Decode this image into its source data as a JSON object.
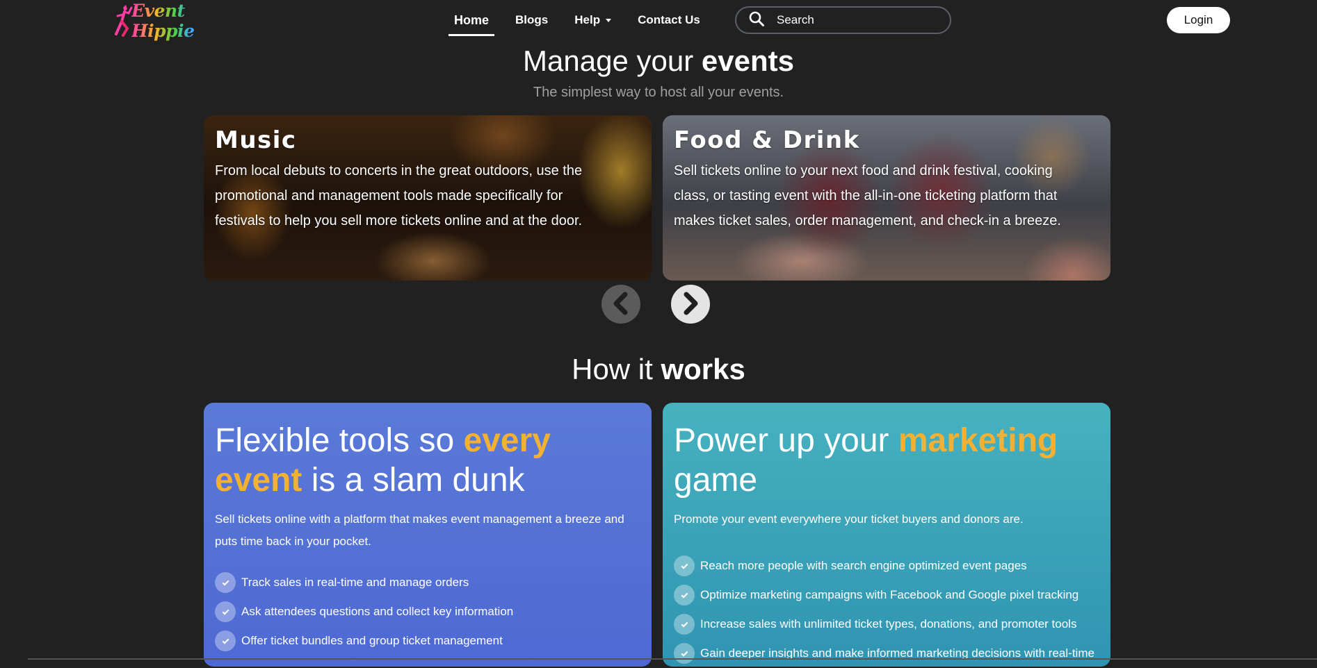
{
  "brand": {
    "name": "Event Hippie"
  },
  "nav": {
    "links": [
      {
        "label": "Home"
      },
      {
        "label": "Blogs"
      },
      {
        "label": "Help"
      },
      {
        "label": "Contact Us"
      }
    ],
    "search_placeholder": "Search",
    "login_label": "Login"
  },
  "hero": {
    "title_prefix": "Manage your",
    "title_bold": "events",
    "subtitle": "The simplest way to host all your events."
  },
  "carousel": {
    "cards": [
      {
        "title": "Music",
        "text": "From local debuts to concerts in the great outdoors, use the promotional and management tools made specifically for festivals to help you sell more tickets online and at the door."
      },
      {
        "title": "Food & Drink",
        "text": "Sell tickets online to your next food and drink festival, cooking class, or tasting event with the all-in-one ticketing platform that makes ticket sales, order management, and check-in a breeze."
      }
    ],
    "prev_icon": "chevron-left-icon",
    "next_icon": "chevron-right-icon"
  },
  "how": {
    "title_prefix": "How it",
    "title_bold": "works",
    "features": [
      {
        "heading_pre": "Flexible tools so ",
        "heading_hl": "every event",
        "heading_post": " is a slam dunk",
        "desc": "Sell tickets online with a platform that makes event management a breeze and puts time back in your pocket.",
        "items": [
          "Track sales in real-time and manage orders",
          "Ask attendees questions and collect key information",
          "Offer ticket bundles and group ticket management"
        ]
      },
      {
        "heading_pre": "Power up your ",
        "heading_hl": "marketing",
        "heading_post": " game",
        "desc": "Promote your event everywhere your ticket buyers and donors are.",
        "items": [
          "Reach more people with search engine optimized event pages",
          "Optimize marketing campaigns with Facebook and Google pixel tracking",
          "Increase sales with unlimited ticket types, donations, and promoter tools",
          "Gain deeper insights and make informed marketing decisions with real-time"
        ]
      }
    ]
  },
  "colors": {
    "background": "#212121",
    "highlight": "#f2b134",
    "card_blue": "#5670d6",
    "card_teal": "#3aa3b8"
  }
}
